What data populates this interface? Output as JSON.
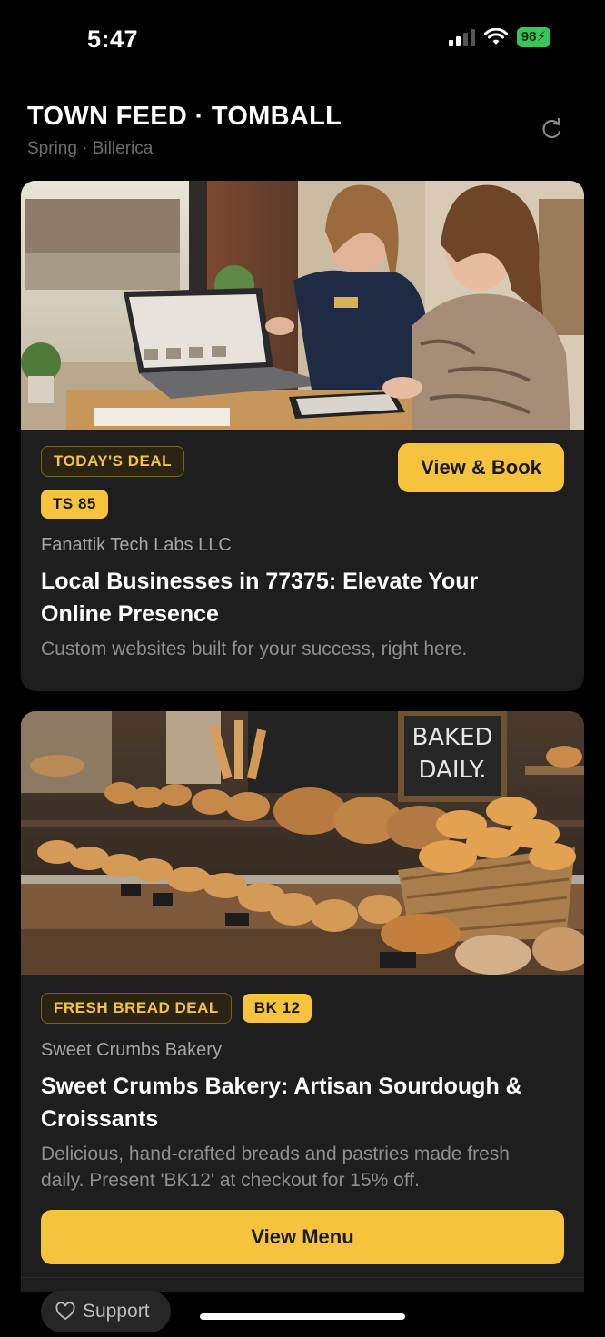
{
  "status": {
    "time": "5:47",
    "battery": "98"
  },
  "header": {
    "title": "TOWN FEED · TOMBALL",
    "subtitle": "Spring · Billerica"
  },
  "deals": [
    {
      "badge": "TODAY'S DEAL",
      "code": "TS 85",
      "business": "Fanattik Tech Labs LLC",
      "headline": "Local Businesses in 77375: Elevate Your Online Presence",
      "description": "Custom websites built for your success, right here.",
      "cta": "View & Book"
    },
    {
      "badge": "FRESH BREAD DEAL",
      "code": "BK 12",
      "business": "Sweet Crumbs Bakery",
      "headline": "Sweet Crumbs Bakery: Artisan Sourdough & Croissants",
      "description": "Delicious, hand-crafted breads and pastries made fresh daily. Present 'BK12' at checkout for 15% off.",
      "cta": "View Menu",
      "sign_text": [
        "BAKED",
        "DAILY."
      ]
    }
  ],
  "footer": {
    "support_label": "Support"
  },
  "colors": {
    "accent": "#f6c33c",
    "card": "#1e1e1e",
    "background": "#000000"
  }
}
